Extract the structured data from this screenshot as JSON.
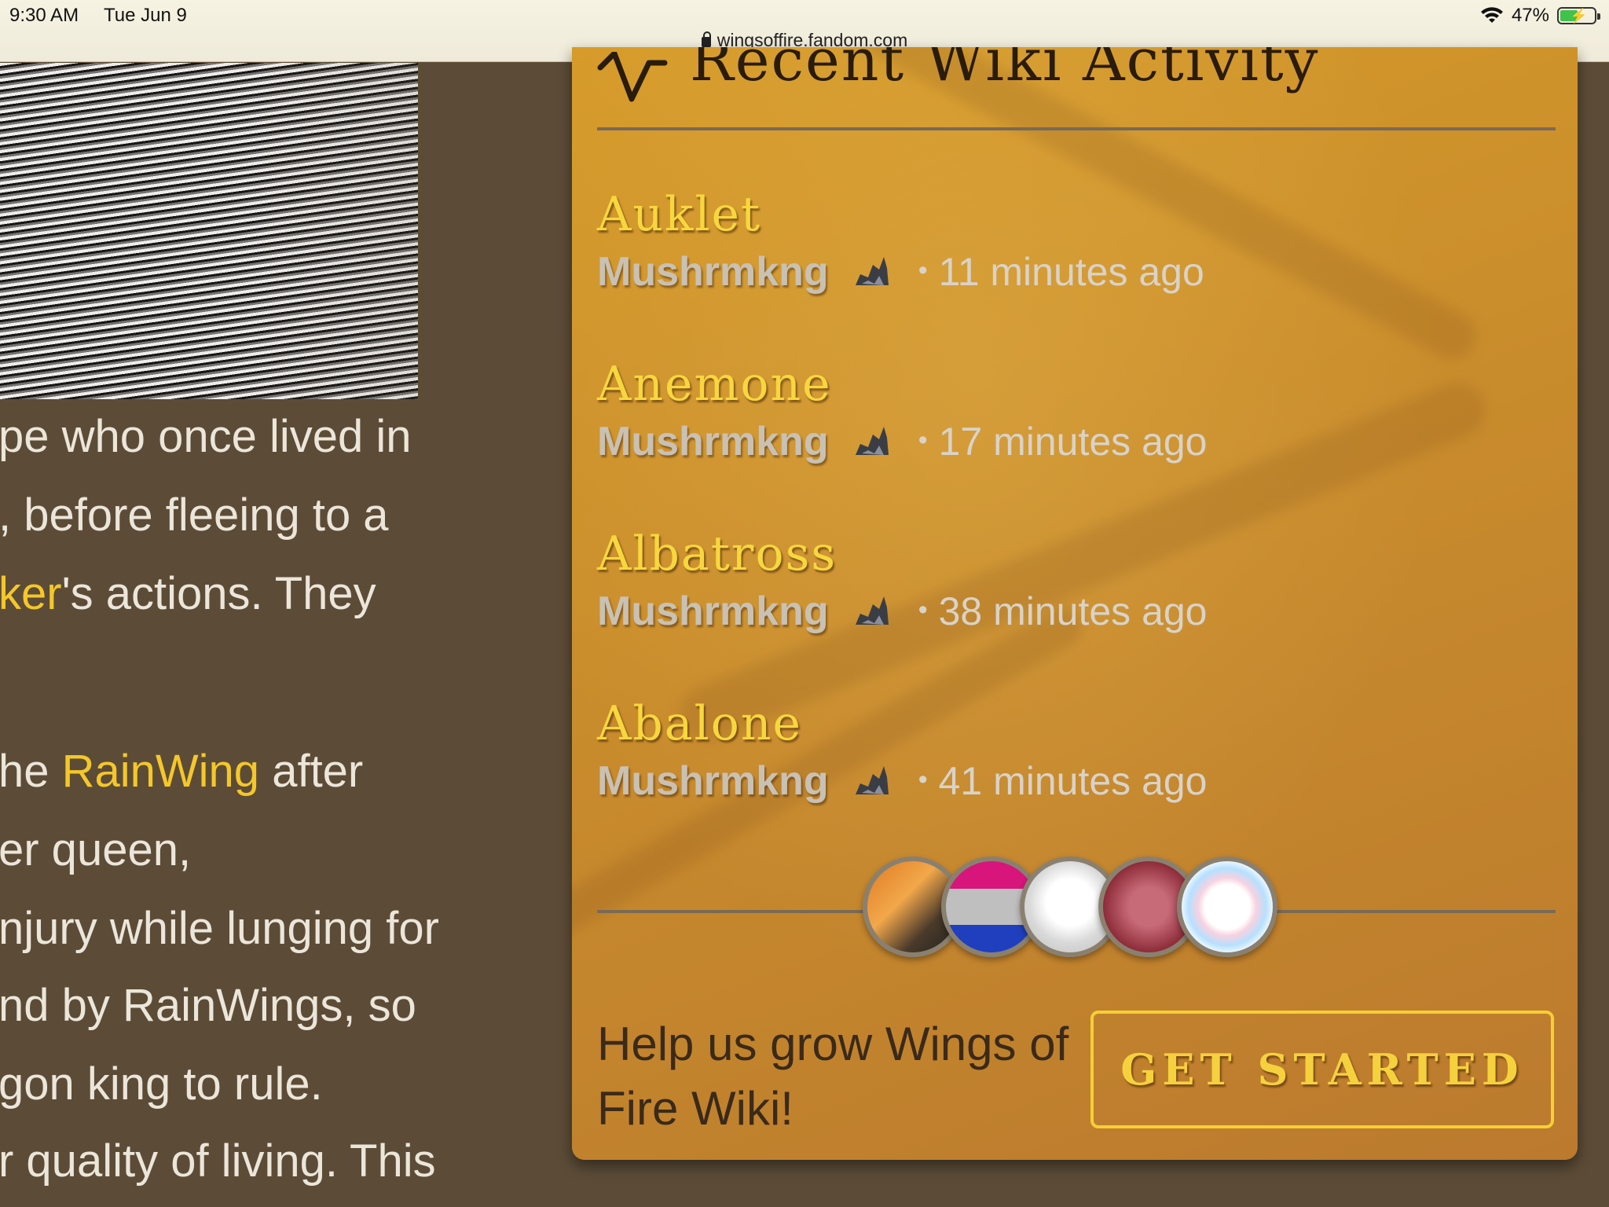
{
  "status_bar": {
    "time": "9:30 AM",
    "date": "Tue Jun 9",
    "battery": "47%",
    "wifi_icon": "wifi-icon",
    "battery_icon": "battery-charging-icon"
  },
  "address_bar": {
    "url": "wingsoffire.fandom.com",
    "lock_icon": "lock-icon"
  },
  "article": {
    "lines": [
      {
        "before": "pe who once lived in",
        "link": "",
        "after": ""
      },
      {
        "before": ", before fleeing to a",
        "link": "",
        "after": ""
      },
      {
        "before": "",
        "link": "ker",
        "after": "'s actions. They"
      },
      {
        "before": "he ",
        "link": "RainWing",
        "after": " after"
      },
      {
        "before": "er queen,",
        "link": "",
        "after": ""
      },
      {
        "before": "njury while lunging for",
        "link": "",
        "after": ""
      },
      {
        "before": "nd by RainWings, so",
        "link": "",
        "after": ""
      },
      {
        "before": "gon king to rule.",
        "link": "",
        "after": ""
      },
      {
        "before": "r quality of living. This",
        "link": "",
        "after": ""
      }
    ]
  },
  "panel": {
    "title": "Recent Wiki Activity",
    "icon": "activity-pulse-icon",
    "items": [
      {
        "title": "Auklet",
        "user": "Mushrmkng",
        "time": "11 minutes ago"
      },
      {
        "title": "Anemone",
        "user": "Mushrmkng",
        "time": "17 minutes ago"
      },
      {
        "title": "Albatross",
        "user": "Mushrmkng",
        "time": "38 minutes ago"
      },
      {
        "title": "Abalone",
        "user": "Mushrmkng",
        "time": "41 minutes ago"
      }
    ],
    "avatars": [
      "avatar-1",
      "avatar-2",
      "avatar-3",
      "avatar-4",
      "avatar-5"
    ],
    "cta_text": "Help us grow Wings of Fire Wiki!",
    "cta_button": "GET STARTED",
    "colors": {
      "panel": "#c98c2c",
      "title_text": "#f7d73e",
      "button_border": "#f6cf35",
      "link": "#f4c72a"
    }
  }
}
